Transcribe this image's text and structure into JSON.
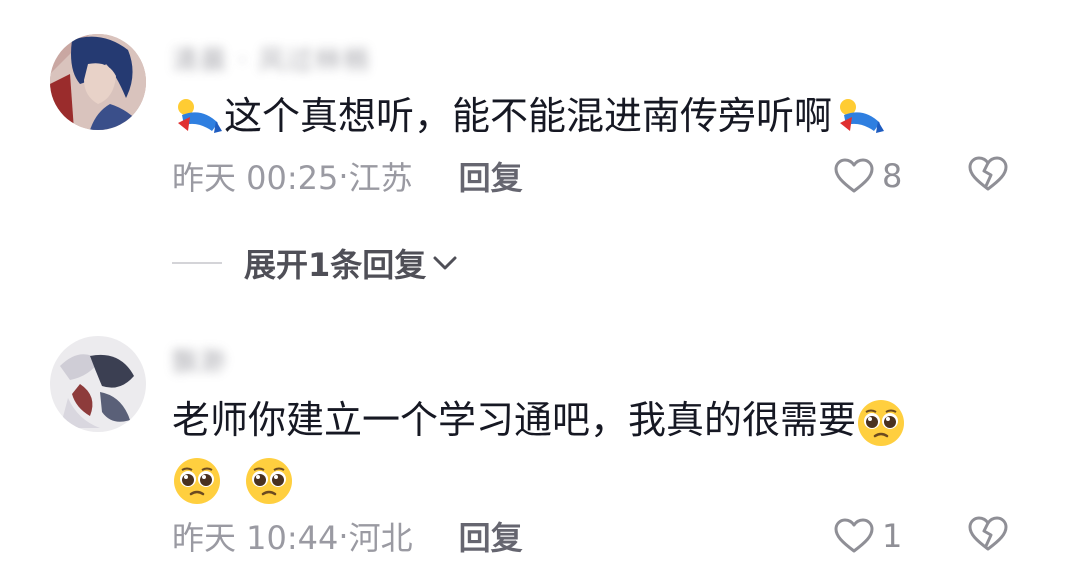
{
  "comments": [
    {
      "username": "清晨 · 风过林梢",
      "text_main": "这个真想听，能不能混进南传旁听啊",
      "time": "昨天 00:25",
      "location": "江苏",
      "reply_label": "回复",
      "likes": "8",
      "emoji": "lying-figure"
    },
    {
      "username": "飘渺",
      "text_line1": "老师你建立一个学习通吧，我真的很需要",
      "time": "昨天 10:44",
      "location": "河北",
      "reply_label": "回复",
      "likes": "1",
      "emoji": "pleading-face"
    }
  ],
  "expand_replies": {
    "label": "展开1条回复"
  },
  "colors": {
    "text": "#161823",
    "meta": "#9a9aa2",
    "icon": "#8f8f96"
  }
}
